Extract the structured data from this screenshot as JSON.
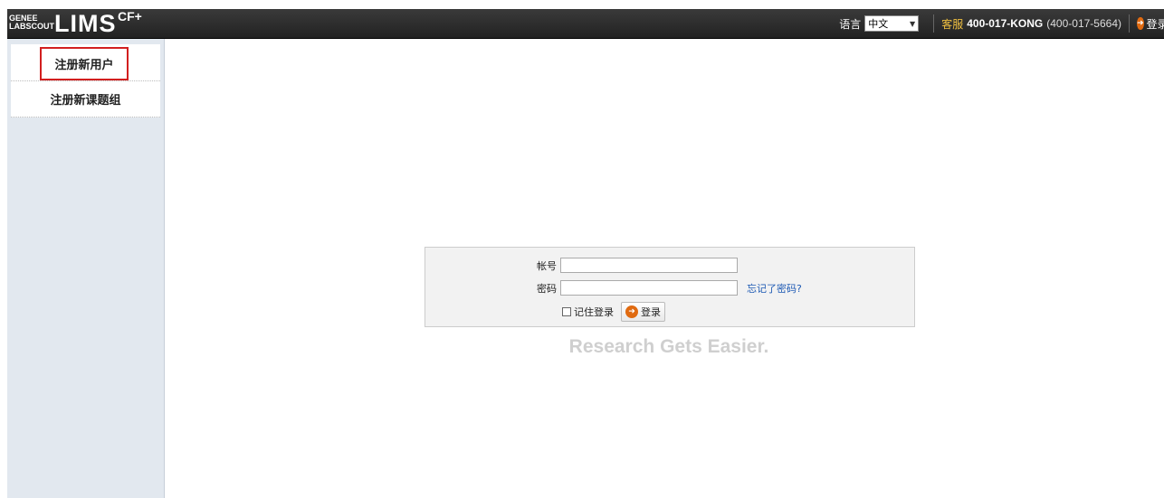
{
  "header": {
    "logo": {
      "brand_top": "GENEE",
      "brand_bottom": "LABSCOUT",
      "product": "LIMS",
      "edition": "CF+"
    },
    "language_label": "语言",
    "language_value": "中文",
    "service_label": "客服",
    "service_phone": "400-017-KONG",
    "service_phone_alt": "(400-017-5664)",
    "login_label": "登录"
  },
  "sidebar": {
    "items": [
      {
        "label": "注册新用户"
      },
      {
        "label": "注册新课题组"
      }
    ]
  },
  "login_form": {
    "account_label": "帐号",
    "account_value": "",
    "password_label": "密码",
    "password_value": "",
    "forgot_label": "忘记了密码?",
    "remember_label": "记住登录",
    "submit_label": "登录"
  },
  "tagline": "Research Gets Easier.",
  "colors": {
    "accent_orange": "#e06a10",
    "link_blue": "#1e5ab4",
    "highlight_red": "#d21f1f",
    "sidebar_bg": "#e2e8ef"
  },
  "icons": {
    "login_icon": "orange-circle-arrow-icon",
    "dropdown": "chevron-down-icon"
  }
}
